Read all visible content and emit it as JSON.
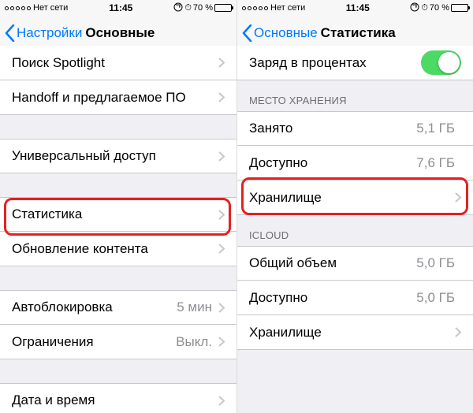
{
  "status": {
    "carrier": "Нет сети",
    "time": "11:45",
    "battery_pct": "70 %"
  },
  "left": {
    "back_label": "Настройки",
    "title": "Основные",
    "rows": {
      "spotlight": "Поиск Spotlight",
      "handoff": "Handoff и предлагаемое ПО",
      "accessibility": "Универсальный доступ",
      "stats": "Статистика",
      "refresh": "Обновление контента",
      "autolock": "Автоблокировка",
      "autolock_val": "5 мин",
      "restrictions": "Ограничения",
      "restrictions_val": "Выкл.",
      "datetime": "Дата и время"
    }
  },
  "right": {
    "back_label": "Основные",
    "title": "Статистика",
    "rows": {
      "battery_pct_row": "Заряд в процентах",
      "storage_header": "МЕСТО ХРАНЕНИЯ",
      "used": "Занято",
      "used_val": "5,1 ГБ",
      "avail": "Доступно",
      "avail_val": "7,6 ГБ",
      "storage": "Хранилище",
      "icloud_header": "ICLOUD",
      "total": "Общий объем",
      "total_val": "5,0 ГБ",
      "icloud_avail": "Доступно",
      "icloud_avail_val": "5,0 ГБ",
      "icloud_storage": "Хранилище"
    }
  }
}
